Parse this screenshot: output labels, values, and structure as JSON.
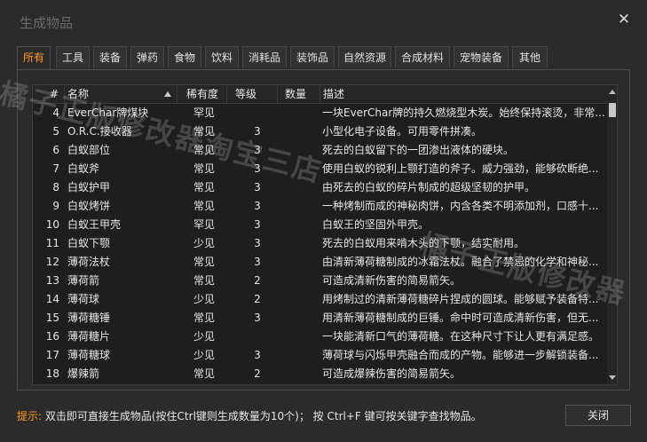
{
  "window": {
    "title": "生成物品",
    "close_glyph": "✕"
  },
  "tabs": [
    {
      "label": "所有",
      "active": true
    },
    {
      "label": "工具"
    },
    {
      "label": "装备"
    },
    {
      "label": "弹药"
    },
    {
      "label": "食物"
    },
    {
      "label": "饮料"
    },
    {
      "label": "消耗品"
    },
    {
      "label": "装饰品"
    },
    {
      "label": "自然资源"
    },
    {
      "label": "合成材料"
    },
    {
      "label": "宠物装备"
    },
    {
      "label": "其他"
    }
  ],
  "table": {
    "columns": [
      "#",
      "名称",
      "稀有度",
      "等级",
      "数量",
      "描述"
    ],
    "sort_column": "名称",
    "rows": [
      {
        "idx": "4",
        "name": "EverChar牌煤块",
        "rarity": "罕见",
        "level": "",
        "qty": "",
        "desc": "一块EverChar牌的持久燃烧型木炭。始终保持滚烫，非常..."
      },
      {
        "idx": "5",
        "name": "O.R.C.接收器",
        "rarity": "常见",
        "level": "3",
        "qty": "",
        "desc": "小型化电子设备。可用零件拼凑。"
      },
      {
        "idx": "6",
        "name": "白蚁部位",
        "rarity": "常见",
        "level": "3",
        "qty": "",
        "desc": "死去的白蚁留下的一团渗出液体的硬块。"
      },
      {
        "idx": "7",
        "name": "白蚁斧",
        "rarity": "常见",
        "level": "3",
        "qty": "",
        "desc": "使用白蚁的锐利上颚打造的斧子。威力强劲，能够砍断绝..."
      },
      {
        "idx": "8",
        "name": "白蚁护甲",
        "rarity": "常见",
        "level": "3",
        "qty": "",
        "desc": "由死去的白蚁的碎片制成的超级坚韧的护甲。"
      },
      {
        "idx": "9",
        "name": "白蚁烤饼",
        "rarity": "常见",
        "level": "3",
        "qty": "",
        "desc": "一种烤制而成的神秘肉饼，内含各类不明添加剂，口感十..."
      },
      {
        "idx": "10",
        "name": "白蚁王甲壳",
        "rarity": "罕见",
        "level": "3",
        "qty": "",
        "desc": "白蚁王的坚固外甲壳。"
      },
      {
        "idx": "11",
        "name": "白蚁下颚",
        "rarity": "少见",
        "level": "3",
        "qty": "",
        "desc": "死去的白蚁用来啃木头的下颚，结实耐用。"
      },
      {
        "idx": "12",
        "name": "薄荷法杖",
        "rarity": "常见",
        "level": "3",
        "qty": "",
        "desc": "由清新薄荷糖制成的冰霜法杖。融合了禁忌的化学和神秘..."
      },
      {
        "idx": "13",
        "name": "薄荷箭",
        "rarity": "常见",
        "level": "2",
        "qty": "",
        "desc": "可造成清新伤害的简易箭矢。"
      },
      {
        "idx": "14",
        "name": "薄荷球",
        "rarity": "少见",
        "level": "2",
        "qty": "",
        "desc": "用烤制过的清新薄荷糖碎片捏成的圆球。能够赋予装备特..."
      },
      {
        "idx": "15",
        "name": "薄荷糖锤",
        "rarity": "常见",
        "level": "3",
        "qty": "",
        "desc": "用清新薄荷糖制成的巨锤。命中时可造成清新伤害，但无..."
      },
      {
        "idx": "16",
        "name": "薄荷糖片",
        "rarity": "少见",
        "level": "",
        "qty": "",
        "desc": "一块能清新口气的薄荷糖。在这种尺寸下让人更有满足感。"
      },
      {
        "idx": "17",
        "name": "薄荷糖球",
        "rarity": "少见",
        "level": "3",
        "qty": "",
        "desc": "薄荷球与闪烁甲壳融合而成的产物。能够进一步解锁装备..."
      },
      {
        "idx": "18",
        "name": "爆辣箭",
        "rarity": "常见",
        "level": "2",
        "qty": "",
        "desc": "可造成爆辣伤害的简易箭矢。"
      }
    ]
  },
  "footer": {
    "hint_label": "提示:",
    "hint_text": "双击即可直接生成物品(按住Ctrl键则生成数量为10个)； 按 Ctrl+F 键可按关键字查找物品。",
    "close_label": "关闭"
  },
  "watermark": [
    "橘子正版修改器淘宝三店",
    "橘子正版修改器"
  ],
  "colors": {
    "accent": "#ff9a1f",
    "background": "#2b2b2b",
    "grid": "#1e1e1e"
  }
}
